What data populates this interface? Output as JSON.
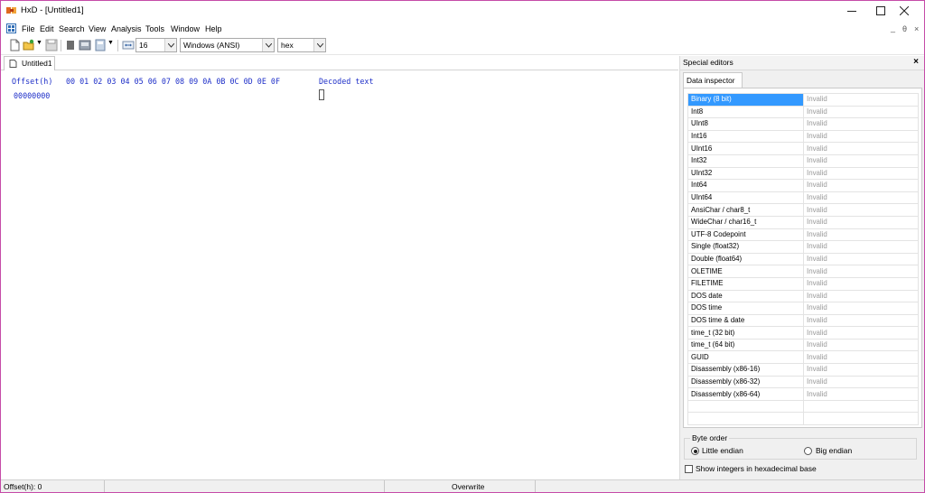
{
  "window": {
    "title": "HxD - [Untitled1]",
    "border_color": "#c54ba8"
  },
  "caption_buttons": [
    "minimize",
    "maximize",
    "close"
  ],
  "menu": {
    "items": [
      "File",
      "Edit",
      "Search",
      "View",
      "Analysis",
      "Tools",
      "Window",
      "Help"
    ],
    "mdi_buttons": [
      "_",
      "θ",
      "×"
    ]
  },
  "toolbar": {
    "icons": [
      "new-file-icon",
      "open-file-icon",
      "save-icon",
      "dropdown-arrow-icon",
      "stop-icon",
      "disk-icon",
      "save-all-icon",
      "dropdown-arrow-icon",
      "columns-icon"
    ],
    "bytes_per_row": "16",
    "charset": "Windows (ANSI)",
    "offset_base": "hex"
  },
  "document_tab": {
    "label": "Untitled1"
  },
  "hex_view": {
    "offset_header": "Offset(h)",
    "column_headers": "00 01 02 03 04 05 06 07 08 09 0A 0B 0C 0D 0E 0F",
    "decoded_header": "Decoded text",
    "first_offset": "00000000",
    "text_color": "#1e2fc8"
  },
  "side_panel": {
    "title": "Special editors",
    "close_label": "×",
    "tab_label": "Data inspector",
    "selection_color": "#3399ff",
    "rows": [
      {
        "type": "Binary (8 bit)",
        "value": "Invalid"
      },
      {
        "type": "Int8",
        "value": "Invalid"
      },
      {
        "type": "UInt8",
        "value": "Invalid"
      },
      {
        "type": "Int16",
        "value": "Invalid"
      },
      {
        "type": "UInt16",
        "value": "Invalid"
      },
      {
        "type": "Int32",
        "value": "Invalid"
      },
      {
        "type": "UInt32",
        "value": "Invalid"
      },
      {
        "type": "Int64",
        "value": "Invalid"
      },
      {
        "type": "UInt64",
        "value": "Invalid"
      },
      {
        "type": "AnsiChar / char8_t",
        "value": "Invalid"
      },
      {
        "type": "WideChar / char16_t",
        "value": "Invalid"
      },
      {
        "type": "UTF-8 Codepoint",
        "value": "Invalid"
      },
      {
        "type": "Single (float32)",
        "value": "Invalid"
      },
      {
        "type": "Double (float64)",
        "value": "Invalid"
      },
      {
        "type": "OLETIME",
        "value": "Invalid"
      },
      {
        "type": "FILETIME",
        "value": "Invalid"
      },
      {
        "type": "DOS date",
        "value": "Invalid"
      },
      {
        "type": "DOS time",
        "value": "Invalid"
      },
      {
        "type": "DOS time & date",
        "value": "Invalid"
      },
      {
        "type": "time_t (32 bit)",
        "value": "Invalid"
      },
      {
        "type": "time_t (64 bit)",
        "value": "Invalid"
      },
      {
        "type": "GUID",
        "value": "Invalid"
      },
      {
        "type": "Disassembly (x86-16)",
        "value": "Invalid"
      },
      {
        "type": "Disassembly (x86-32)",
        "value": "Invalid"
      },
      {
        "type": "Disassembly (x86-64)",
        "value": "Invalid"
      },
      {
        "type": "",
        "value": ""
      },
      {
        "type": "",
        "value": ""
      }
    ],
    "byte_order": {
      "legend": "Byte order",
      "little": "Little endian",
      "big": "Big endian",
      "selected": "little"
    },
    "hex_integers_label": "Show integers in hexadecimal base",
    "hex_integers_checked": false
  },
  "status_bar": {
    "offset": "Offset(h): 0",
    "mode": "Overwrite"
  }
}
